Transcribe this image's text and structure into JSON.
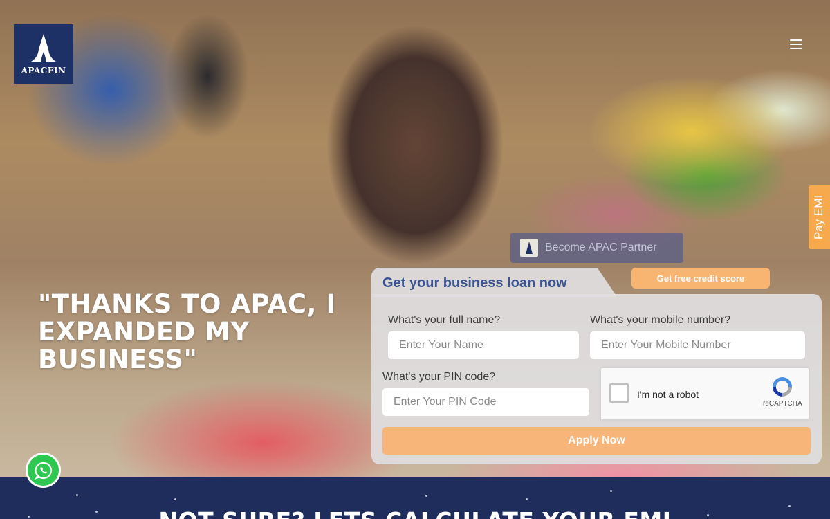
{
  "brand": {
    "name": "APACFIN",
    "color": "#1d3166"
  },
  "nav": {
    "menu_icon": "hamburger-icon"
  },
  "side_tab": {
    "label": "Pay EMI",
    "color": "#f7a94e"
  },
  "partner": {
    "label": "Become APAC Partner"
  },
  "hero": {
    "headline": "\"THANKS TO APAC, I EXPANDED MY BUSINESS\""
  },
  "form": {
    "title": "Get your business loan now",
    "credit_score_label": "Get free credit score",
    "name": {
      "label": "What's your full name?",
      "placeholder": "Enter Your Name"
    },
    "mobile": {
      "label": "What's your mobile number?",
      "placeholder": "Enter Your Mobile Number"
    },
    "pin": {
      "label": "What's your PIN code?",
      "placeholder": "Enter Your PIN Code"
    },
    "captcha": {
      "label": "I'm not a robot",
      "brand": "reCAPTCHA"
    },
    "submit_label": "Apply Now",
    "accent_color": "#f7b571",
    "title_color": "#3c5490"
  },
  "whatsapp": {
    "icon": "whatsapp-icon",
    "color": "#2ec74f"
  },
  "emi_section": {
    "heading": "NOT SURE? LETS CALCULATE YOUR EMI",
    "background": "#1e2d5c"
  }
}
